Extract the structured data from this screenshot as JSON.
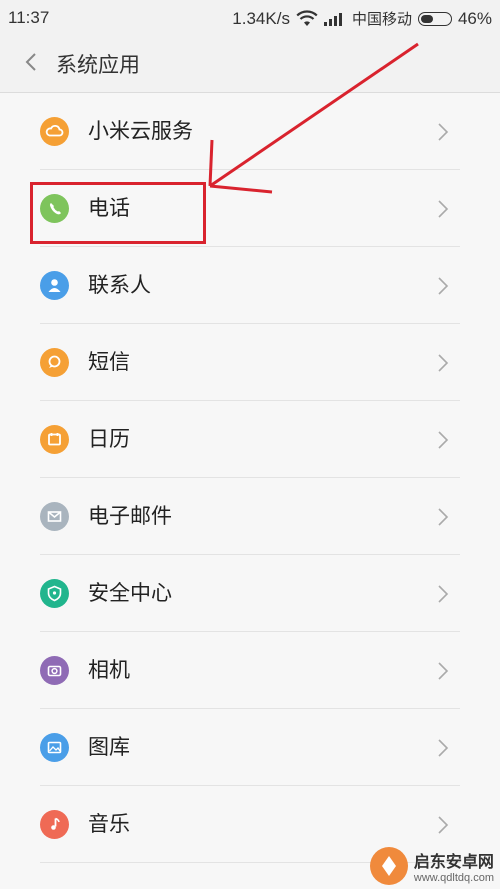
{
  "status_bar": {
    "time": "11:37",
    "speed": "1.34K/s",
    "carrier": "中国移动",
    "battery_percent": "46%",
    "battery_level": 0.46
  },
  "header": {
    "title": "系统应用"
  },
  "list": {
    "items": [
      {
        "label": "小米云服务",
        "icon": "cloud-icon",
        "color": "#f5a035"
      },
      {
        "label": "电话",
        "icon": "phone-icon",
        "color": "#7ec45c"
      },
      {
        "label": "联系人",
        "icon": "contacts-icon",
        "color": "#4a9ee8"
      },
      {
        "label": "短信",
        "icon": "message-icon",
        "color": "#f5a035"
      },
      {
        "label": "日历",
        "icon": "calendar-icon",
        "color": "#f5a035"
      },
      {
        "label": "电子邮件",
        "icon": "email-icon",
        "color": "#a9b4be"
      },
      {
        "label": "安全中心",
        "icon": "security-icon",
        "color": "#21b58d"
      },
      {
        "label": "相机",
        "icon": "camera-icon",
        "color": "#8f6bb5"
      },
      {
        "label": "图库",
        "icon": "gallery-icon",
        "color": "#4a9ee8"
      },
      {
        "label": "音乐",
        "icon": "music-icon",
        "color": "#ef6a55"
      }
    ]
  },
  "annotation": {
    "color": "#d9232e"
  },
  "watermark": {
    "brand": "启东安卓网",
    "url": "www.qdltdq.com"
  }
}
